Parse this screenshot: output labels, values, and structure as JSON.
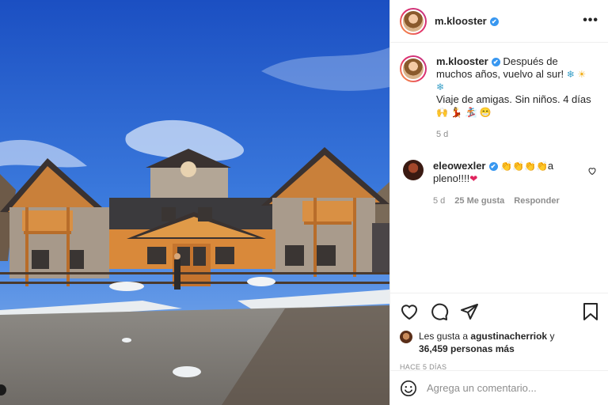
{
  "post": {
    "author": "m.klooster",
    "verified_mark": "✔"
  },
  "caption": {
    "text_1": "Después de muchos años, vuelvo al sur!",
    "text_2": "Viaje de amigas. Sin niños. 4 días",
    "emoji_snow": "❄",
    "emoji_sun": "☀",
    "emoji_extra": "🙌 💃 🏂 😁",
    "time": "5 d"
  },
  "comment": {
    "author": "eleowexler",
    "emoji_claps": "👏👏👏👏",
    "text_1": "a",
    "text_2": "pleno!!!!",
    "emoji_heart": "❤",
    "time": "5 d",
    "likes": "25 Me gusta",
    "reply": "Responder"
  },
  "likes": {
    "prefix": "Les gusta a",
    "user": "agustinacherriok",
    "suffix": "y",
    "count": "36,459 personas más"
  },
  "timestamp": "HACE 5 DÍAS",
  "add_comment": {
    "placeholder": "Agrega un comentario..."
  },
  "icons": {
    "more": "more-options-icon",
    "like": "heart-icon",
    "comment": "comment-icon",
    "share": "share-icon",
    "save": "bookmark-icon",
    "emoji": "emoji-icon",
    "comment_like": "small-heart-icon"
  },
  "colors": {
    "verified": "#3897f0",
    "muted": "#8e8e8e",
    "text": "#262626"
  }
}
